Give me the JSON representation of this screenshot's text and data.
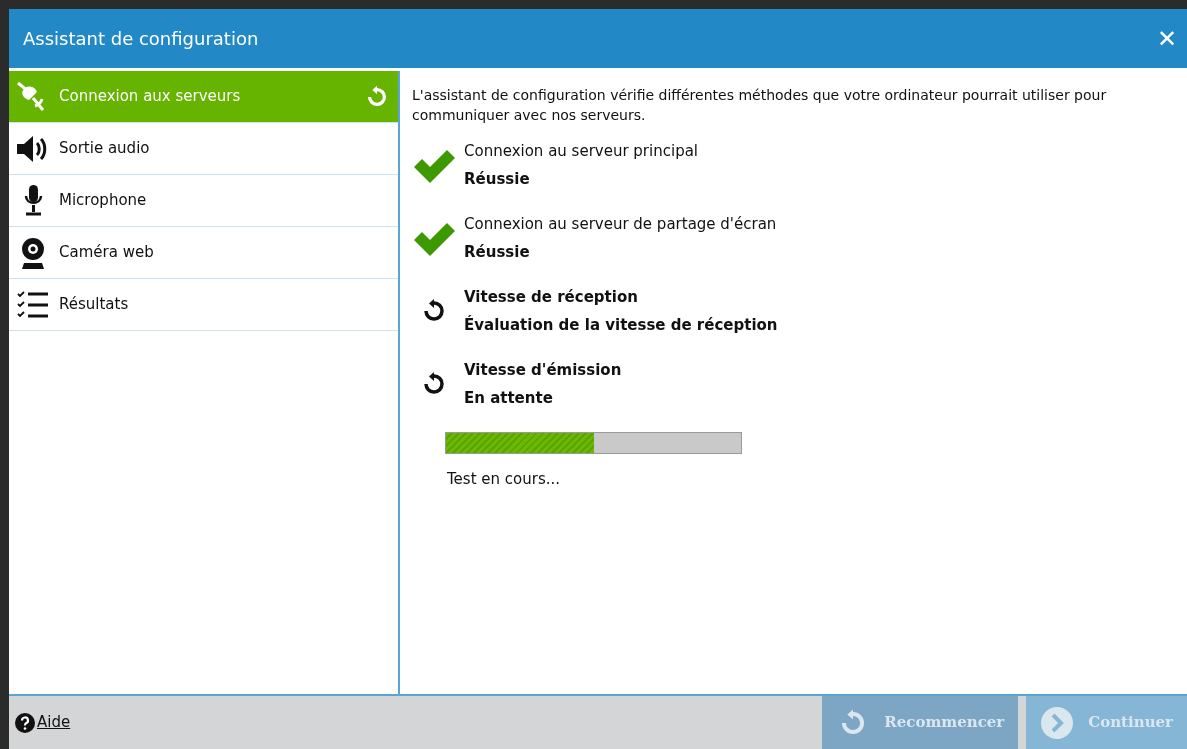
{
  "window": {
    "title": "Assistant de configuration",
    "close": "✕"
  },
  "sidebar": {
    "items": [
      {
        "label": "Connexion aux serveurs",
        "kind": "plug",
        "selected": true,
        "busy": true
      },
      {
        "label": "Sortie audio",
        "kind": "speaker",
        "selected": false,
        "busy": false
      },
      {
        "label": "Microphone",
        "kind": "mic",
        "selected": false,
        "busy": false
      },
      {
        "label": "Caméra web",
        "kind": "webcam",
        "selected": false,
        "busy": false
      },
      {
        "label": "Résultats",
        "kind": "checklist",
        "selected": false,
        "busy": false
      }
    ]
  },
  "content": {
    "intro": "L'assistant de configuration vérifie différentes méthodes que votre ordinateur pourrait utiliser pour communiquer avec nos serveurs.",
    "checks": [
      {
        "kind": "done",
        "title": "Connexion au serveur principal",
        "status": "Réussie"
      },
      {
        "kind": "done",
        "title": "Connexion au serveur de partage d'écran",
        "status": "Réussie"
      },
      {
        "kind": "pending",
        "title": "Vitesse de réception",
        "status": "Évaluation de la vitesse de réception"
      },
      {
        "kind": "pending",
        "title": "Vitesse d'émission",
        "status": "En attente"
      }
    ],
    "progress": {
      "level": 0.5,
      "caption": "Test en cours..."
    }
  },
  "footer": {
    "help": "Aide",
    "buttons": [
      {
        "label": "Recommencer",
        "kind": "restart",
        "disabled": true
      },
      {
        "label": "Continuer",
        "kind": "next",
        "disabled": true
      }
    ]
  }
}
